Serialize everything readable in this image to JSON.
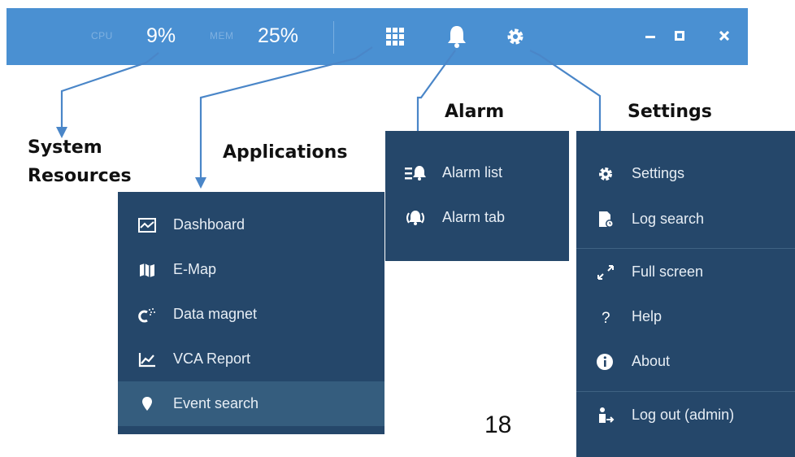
{
  "topbar": {
    "cpu_label": "CPU",
    "cpu_value": "9%",
    "mem_label": "MEM",
    "mem_value": "25%",
    "icons": [
      "apps-grid-icon",
      "bell-icon",
      "gear-icon",
      "minimize-icon",
      "maximize-icon",
      "close-icon"
    ],
    "bar_color": "#4a90d2"
  },
  "callouts": {
    "system_resources": [
      "System",
      "Resources"
    ],
    "applications": "Applications",
    "alarm": "Alarm",
    "settings": "Settings"
  },
  "applications_menu": {
    "items": [
      {
        "label": "Dashboard",
        "icon": "dashboard-icon"
      },
      {
        "label": "E-Map",
        "icon": "map-icon"
      },
      {
        "label": "Data magnet",
        "icon": "magnet-icon"
      },
      {
        "label": "VCA Report",
        "icon": "chart-icon"
      },
      {
        "label": "Event search",
        "icon": "location-pin-icon",
        "active": true
      }
    ]
  },
  "alarm_menu": {
    "items": [
      {
        "label": "Alarm list",
        "icon": "alarm-list-icon"
      },
      {
        "label": "Alarm tab",
        "icon": "alarm-tab-icon"
      }
    ]
  },
  "settings_menu": {
    "items": [
      {
        "label": "Settings",
        "icon": "gear-icon"
      },
      {
        "label": "Log search",
        "icon": "log-search-icon"
      },
      {
        "label": "Full screen",
        "icon": "fullscreen-icon"
      },
      {
        "label": "Help",
        "icon": "help-icon"
      },
      {
        "label": "About",
        "icon": "info-icon"
      },
      {
        "label": "Log out (admin)",
        "icon": "logout-icon"
      }
    ]
  },
  "page_number": "18",
  "colors": {
    "panel_bg": "#25476a",
    "active_row": "#355d7e",
    "arrow": "#4a86c8"
  }
}
